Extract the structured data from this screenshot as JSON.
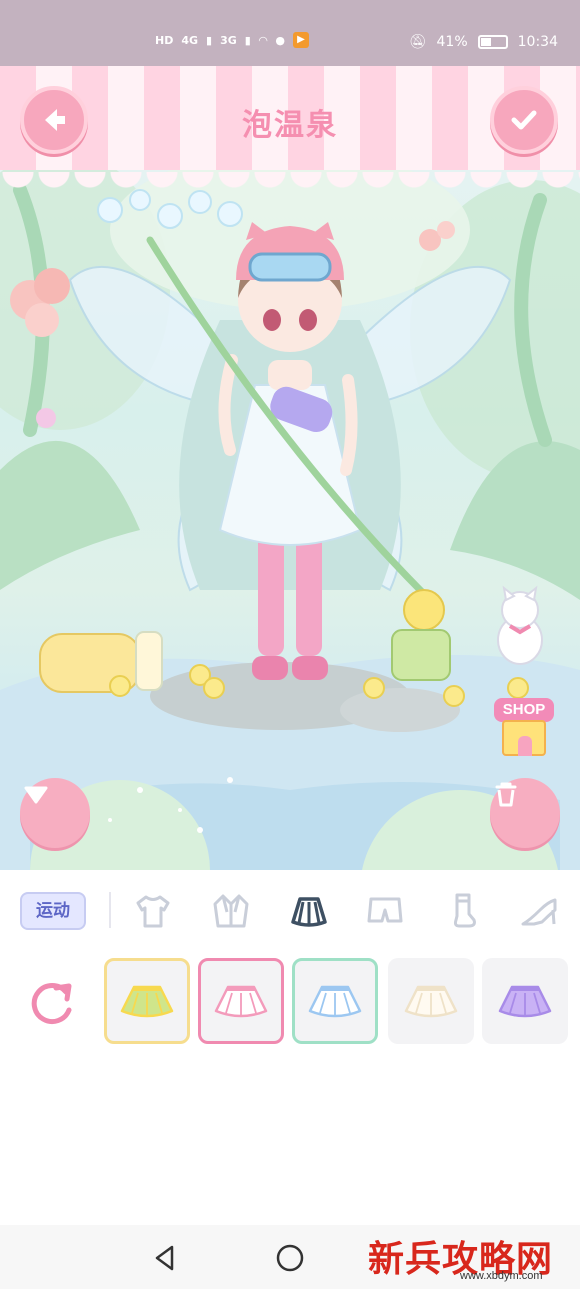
{
  "status_bar": {
    "hd_label": "HD",
    "signal1_label": "4G",
    "signal2_label": "3G",
    "app_badge_icon": "play-icon",
    "battery_percent": "41%",
    "battery_level": 0.41,
    "time": "10:34"
  },
  "header": {
    "title": "泡温泉",
    "back_icon": "arrow-left-icon",
    "confirm_icon": "check-icon"
  },
  "scene": {
    "shop_label": "SHOP",
    "collapse_icon": "triangle-down-icon",
    "delete_icon": "trash-icon"
  },
  "category": {
    "label": "运动",
    "tabs": [
      {
        "icon": "tshirt-icon",
        "selected": false
      },
      {
        "icon": "jacket-icon",
        "selected": false
      },
      {
        "icon": "skirt-icon",
        "selected": true
      },
      {
        "icon": "shorts-icon",
        "selected": false
      },
      {
        "icon": "sock-icon",
        "selected": false
      },
      {
        "icon": "high-heel-icon",
        "selected": false
      }
    ]
  },
  "items": [
    {
      "color": "#cfe58b",
      "accent": "#f7d94f",
      "border": "yellow"
    },
    {
      "color": "#ffffff",
      "accent": "#f39bbb",
      "border": "pink"
    },
    {
      "color": "#ffffff",
      "accent": "#9cc7f1",
      "border": "teal"
    },
    {
      "color": "#fffaf1",
      "accent": "#efe2c8",
      "border": "none"
    },
    {
      "color": "#c9b2f5",
      "accent": "#a88be8",
      "border": "none"
    }
  ],
  "watermark": {
    "main": "新兵攻略网",
    "sub": "www.xbdym.com"
  },
  "colors": {
    "pink_accent": "#f7a7bd",
    "title_pink": "#f58fb0",
    "category_blue": "#5d66c6"
  }
}
